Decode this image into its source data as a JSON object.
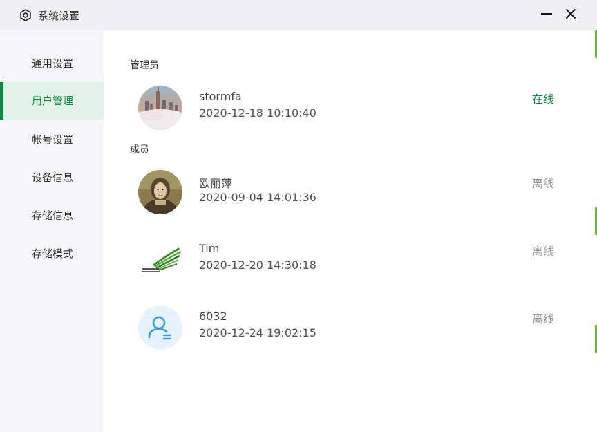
{
  "window": {
    "title": "系统设置",
    "icon": "gear-icon",
    "minimize_icon": "minimize-icon",
    "close_icon": "close-icon"
  },
  "sidebar": {
    "items": [
      {
        "label": "通用设置",
        "active": false
      },
      {
        "label": "用户管理",
        "active": true
      },
      {
        "label": "帐号设置",
        "active": false
      },
      {
        "label": "设备信息",
        "active": false
      },
      {
        "label": "存储信息",
        "active": false
      },
      {
        "label": "存储模式",
        "active": false
      }
    ]
  },
  "main": {
    "admin_section": {
      "label": "管理员",
      "users": [
        {
          "name": "stormfa",
          "time": "2020-12-18 10:10:40",
          "status": "在线",
          "online": true,
          "avatar": "city-photo"
        }
      ]
    },
    "member_section": {
      "label": "成员",
      "users": [
        {
          "name": "欧丽萍",
          "time": "2020-09-04 14:01:36",
          "status": "离线",
          "online": false,
          "avatar": "painting-photo"
        },
        {
          "name": "Tim",
          "time": "2020-12-20 14:30:18",
          "status": "离线",
          "online": false,
          "avatar": "wing-logo"
        },
        {
          "name": "6032",
          "time": "2020-12-24 19:02:15",
          "status": "离线",
          "online": false,
          "avatar": "default-user-icon"
        }
      ]
    }
  },
  "colors": {
    "accent": "#0c8a43",
    "sidebar_bg": "#f5f6fa",
    "active_bg": "#e3f2e9",
    "titlebar_bg": "#eef0f3",
    "offline": "#999999",
    "default_avatar_bg": "#e6f3fd",
    "default_avatar_icon": "#3a9be6"
  }
}
